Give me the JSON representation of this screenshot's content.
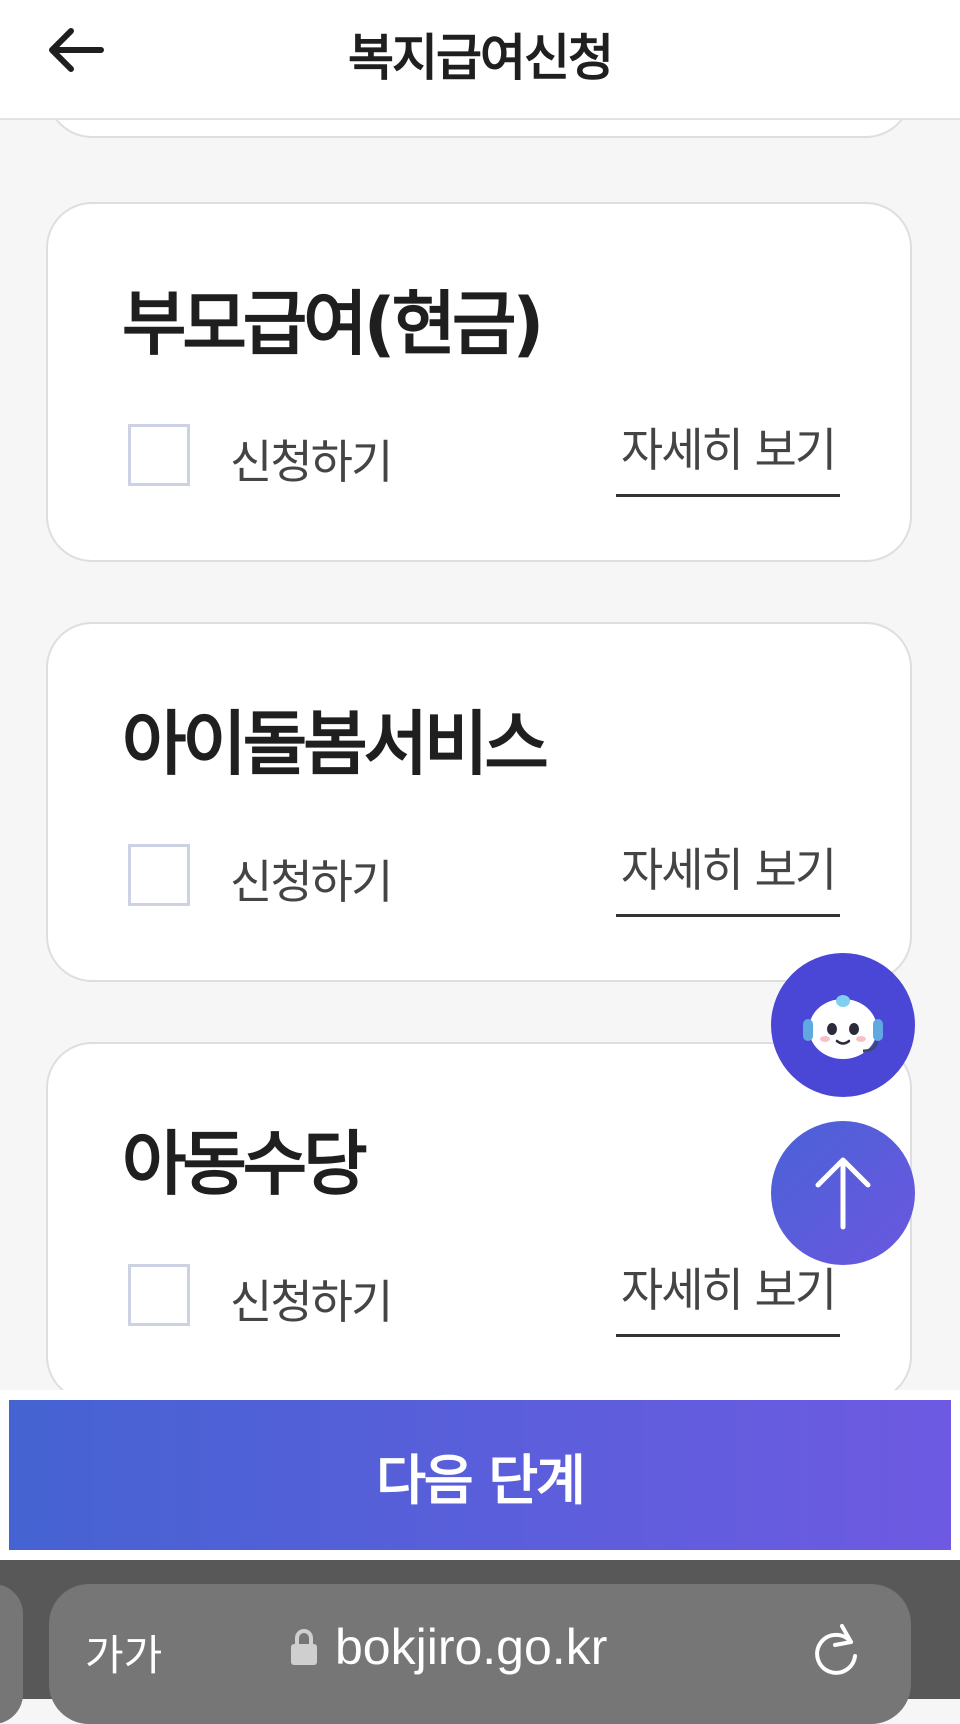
{
  "header": {
    "title": "복지급여신청",
    "back_icon": "arrow-left-icon"
  },
  "cards": [
    {
      "title": "부모급여(현금)",
      "apply_label": "신청하기",
      "detail_label": "자세히 보기",
      "checked": false
    },
    {
      "title": "아이돌봄서비스",
      "apply_label": "신청하기",
      "detail_label": "자세히 보기",
      "checked": false
    },
    {
      "title": "아동수당",
      "apply_label": "신청하기",
      "detail_label": "자세히 보기",
      "checked": false
    }
  ],
  "floating": {
    "chatbot_icon": "robot-headset-icon",
    "scroll_top_icon": "arrow-up-icon"
  },
  "next_button": {
    "label": "다음 단계"
  },
  "browser": {
    "text_size_label": "가가",
    "url": "bokjiro.go.kr",
    "lock_icon": "lock-icon",
    "reload_icon": "reload-icon"
  },
  "colors": {
    "accent_start": "#4563d2",
    "accent_end": "#6e5ae2",
    "chat_fab": "#4b47d6"
  }
}
